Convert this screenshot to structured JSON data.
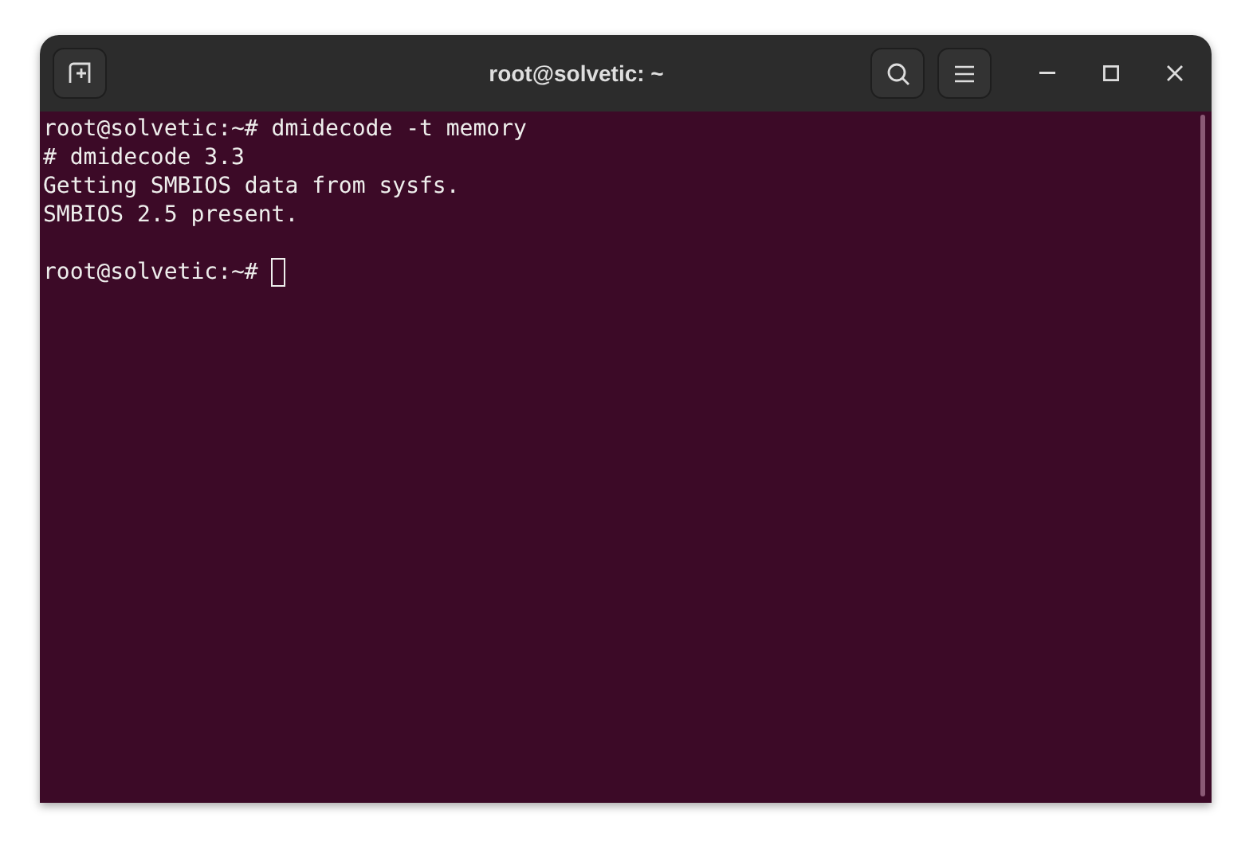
{
  "window": {
    "title": "root@solvetic: ~"
  },
  "terminal": {
    "lines": [
      {
        "kind": "output",
        "text": "root@solvetic:~# dmidecode -t memory"
      },
      {
        "kind": "output",
        "text": "# dmidecode 3.3"
      },
      {
        "kind": "output",
        "text": "Getting SMBIOS data from sysfs."
      },
      {
        "kind": "output",
        "text": "SMBIOS 2.5 present."
      },
      {
        "kind": "blank"
      },
      {
        "kind": "prompt",
        "text": "root@solvetic:~#"
      }
    ]
  }
}
